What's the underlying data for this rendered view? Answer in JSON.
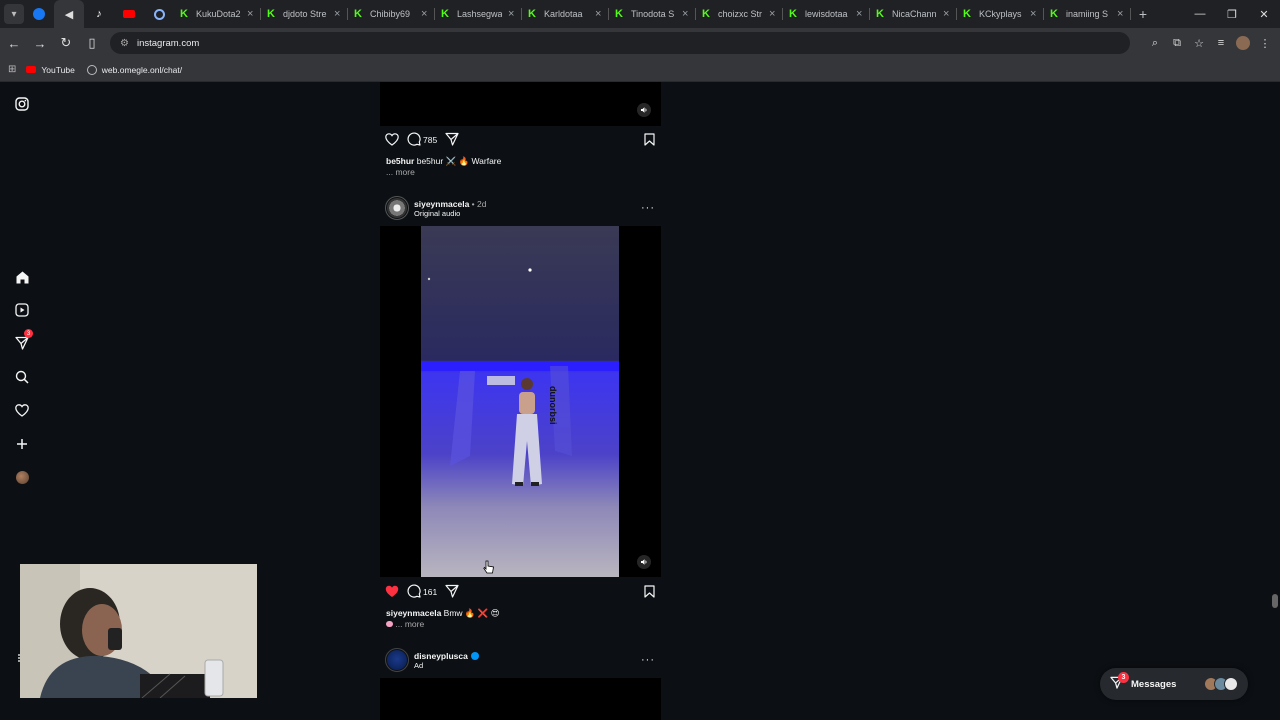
{
  "browser": {
    "tabs": [
      {
        "label": "KukuDota2"
      },
      {
        "label": "djdoto Stre"
      },
      {
        "label": "Chibiby69"
      },
      {
        "label": "Lashsegwa"
      },
      {
        "label": "Karldotaa"
      },
      {
        "label": "Tinodota S"
      },
      {
        "label": "choizxc Str"
      },
      {
        "label": "lewisdotaa"
      },
      {
        "label": "NicaChann"
      },
      {
        "label": "KCkyplays"
      },
      {
        "label": "inamiing S"
      }
    ],
    "url": "instagram.com",
    "bookmarks": [
      {
        "label": "YouTube"
      },
      {
        "label": "web.omegle.onl/chat/"
      }
    ]
  },
  "sidebar": {
    "notification_count": "3"
  },
  "posts": [
    {
      "comment_count": "785",
      "caption_user": "be5hur",
      "caption_text": "be5hur ⚔️ 🔥 Warfare",
      "more_label": "... more"
    },
    {
      "username": "siyeynmacela",
      "time": "• 2d",
      "subtitle": "Original audio",
      "comment_count": "161",
      "caption_user": "siyeynmacela",
      "caption_text": "Bmw 🔥 ❌ 😍",
      "more_label": "... more",
      "liked": true
    },
    {
      "username": "disneyplusca",
      "subtitle": "Ad",
      "verified": true
    }
  ],
  "messages": {
    "label": "Messages",
    "badge": "3"
  },
  "colors": {
    "like_red": "#ff3040",
    "kick_green": "#53fc18",
    "ig_bg": "#0c1014",
    "stage_blue": "#3a2ce0"
  }
}
